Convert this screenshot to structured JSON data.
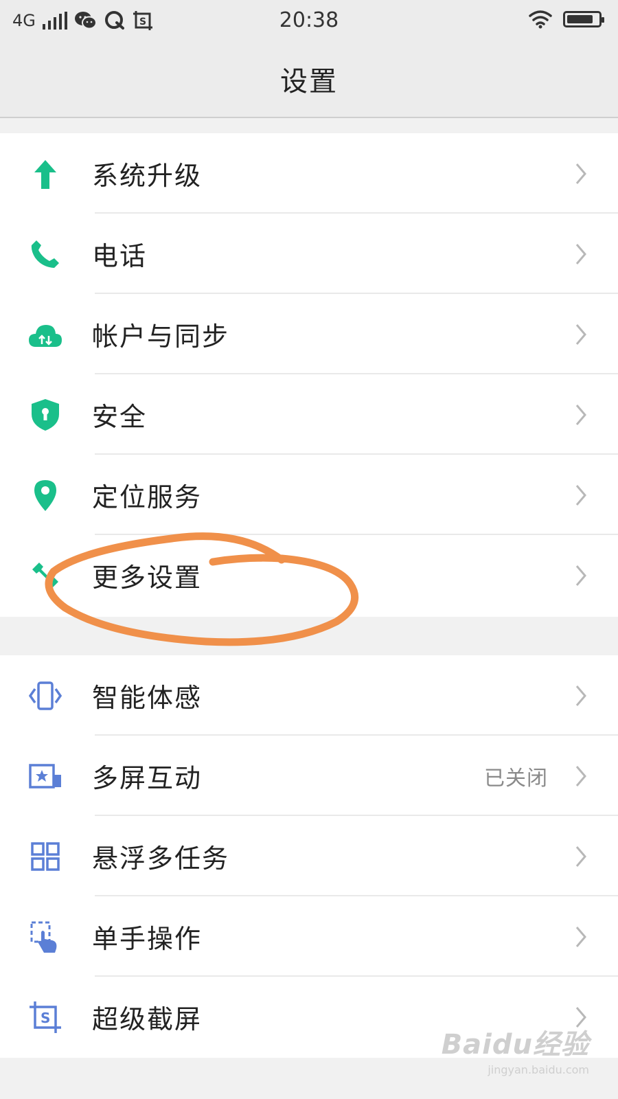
{
  "status_bar": {
    "network": "4G",
    "time": "20:38",
    "battery_level": 0.85
  },
  "header": {
    "title": "设置"
  },
  "colors": {
    "green_accent": "#1abf8a",
    "blue_accent": "#5b7fd6",
    "annotation_orange": "#f0904a"
  },
  "groups": [
    {
      "items": [
        {
          "label": "系统升级",
          "icon": "upgrade-arrow-icon"
        },
        {
          "label": "电话",
          "icon": "phone-icon"
        },
        {
          "label": "帐户与同步",
          "icon": "cloud-sync-icon"
        },
        {
          "label": "安全",
          "icon": "shield-icon"
        },
        {
          "label": "定位服务",
          "icon": "location-pin-icon"
        },
        {
          "label": "更多设置",
          "icon": "wrench-icon"
        }
      ]
    },
    {
      "items": [
        {
          "label": "智能体感",
          "icon": "motion-phone-icon"
        },
        {
          "label": "多屏互动",
          "icon": "multiscreen-icon",
          "value": "已关闭"
        },
        {
          "label": "悬浮多任务",
          "icon": "multitask-icon"
        },
        {
          "label": "单手操作",
          "icon": "one-hand-icon"
        },
        {
          "label": "超级截屏",
          "icon": "screenshot-icon"
        }
      ]
    }
  ],
  "watermark": {
    "logo": "Baidu经验",
    "url": "jingyan.baidu.com"
  }
}
